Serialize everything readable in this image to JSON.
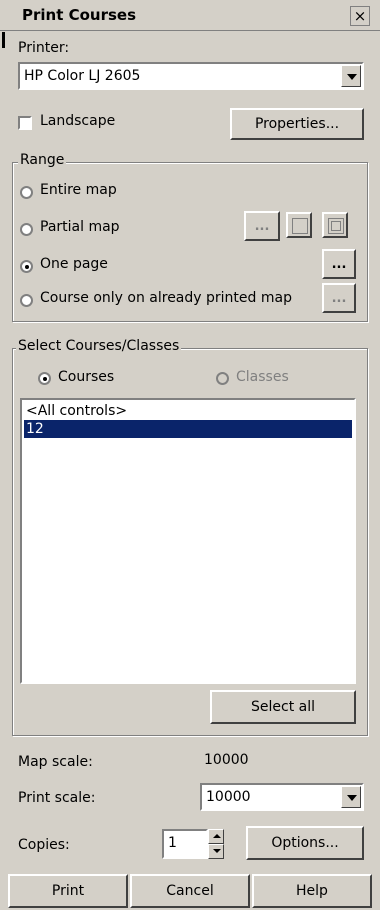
{
  "window": {
    "title": "Print Courses",
    "close_glyph": "×"
  },
  "printer": {
    "label": "Printer:",
    "selected": "HP Color LJ 2605",
    "landscape_label": "Landscape",
    "landscape_checked": false,
    "properties_label": "Properties..."
  },
  "range": {
    "legend": "Range",
    "options": [
      {
        "label": "Entire map",
        "checked": false
      },
      {
        "label": "Partial map",
        "checked": false
      },
      {
        "label": "One page",
        "checked": true
      },
      {
        "label": "Course only on already printed map",
        "checked": false
      }
    ],
    "ellipsis": "..."
  },
  "courses": {
    "legend": "Select Courses/Classes",
    "courses_label": "Courses",
    "classes_label": "Classes",
    "items": [
      "<All controls>",
      "12"
    ],
    "selected_index": 1,
    "select_all_label": "Select all"
  },
  "scale": {
    "map_scale_label": "Map scale:",
    "map_scale_value": "10000",
    "print_scale_label": "Print scale:",
    "print_scale_value": "10000"
  },
  "copies": {
    "label": "Copies:",
    "value": "1",
    "options_label": "Options..."
  },
  "footer": {
    "print_label": "Print",
    "cancel_label": "Cancel",
    "help_label": "Help"
  }
}
